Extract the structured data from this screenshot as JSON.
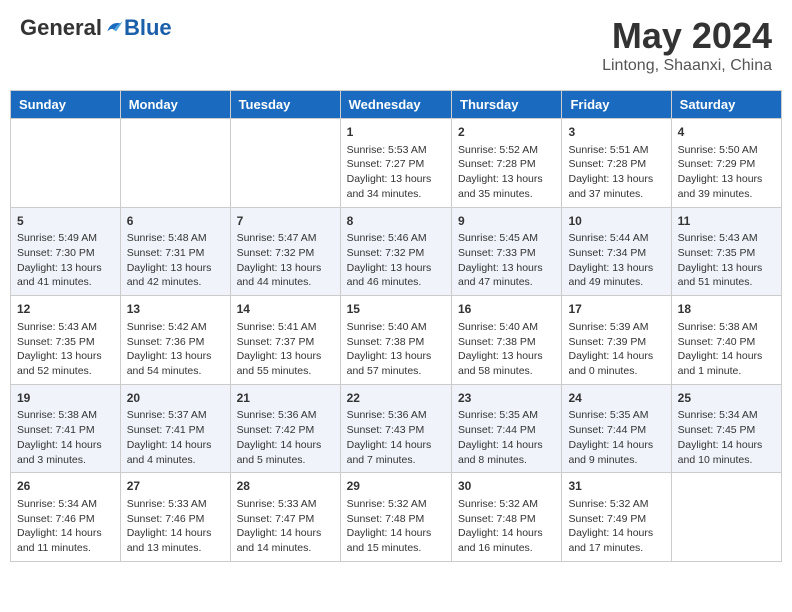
{
  "logo": {
    "general": "General",
    "blue": "Blue"
  },
  "title": "May 2024",
  "subtitle": "Lintong, Shaanxi, China",
  "days": [
    "Sunday",
    "Monday",
    "Tuesday",
    "Wednesday",
    "Thursday",
    "Friday",
    "Saturday"
  ],
  "weeks": [
    [
      {
        "day": "",
        "info": ""
      },
      {
        "day": "",
        "info": ""
      },
      {
        "day": "",
        "info": ""
      },
      {
        "day": "1",
        "info": "Sunrise: 5:53 AM\nSunset: 7:27 PM\nDaylight: 13 hours and 34 minutes."
      },
      {
        "day": "2",
        "info": "Sunrise: 5:52 AM\nSunset: 7:28 PM\nDaylight: 13 hours and 35 minutes."
      },
      {
        "day": "3",
        "info": "Sunrise: 5:51 AM\nSunset: 7:28 PM\nDaylight: 13 hours and 37 minutes."
      },
      {
        "day": "4",
        "info": "Sunrise: 5:50 AM\nSunset: 7:29 PM\nDaylight: 13 hours and 39 minutes."
      }
    ],
    [
      {
        "day": "5",
        "info": "Sunrise: 5:49 AM\nSunset: 7:30 PM\nDaylight: 13 hours and 41 minutes."
      },
      {
        "day": "6",
        "info": "Sunrise: 5:48 AM\nSunset: 7:31 PM\nDaylight: 13 hours and 42 minutes."
      },
      {
        "day": "7",
        "info": "Sunrise: 5:47 AM\nSunset: 7:32 PM\nDaylight: 13 hours and 44 minutes."
      },
      {
        "day": "8",
        "info": "Sunrise: 5:46 AM\nSunset: 7:32 PM\nDaylight: 13 hours and 46 minutes."
      },
      {
        "day": "9",
        "info": "Sunrise: 5:45 AM\nSunset: 7:33 PM\nDaylight: 13 hours and 47 minutes."
      },
      {
        "day": "10",
        "info": "Sunrise: 5:44 AM\nSunset: 7:34 PM\nDaylight: 13 hours and 49 minutes."
      },
      {
        "day": "11",
        "info": "Sunrise: 5:43 AM\nSunset: 7:35 PM\nDaylight: 13 hours and 51 minutes."
      }
    ],
    [
      {
        "day": "12",
        "info": "Sunrise: 5:43 AM\nSunset: 7:35 PM\nDaylight: 13 hours and 52 minutes."
      },
      {
        "day": "13",
        "info": "Sunrise: 5:42 AM\nSunset: 7:36 PM\nDaylight: 13 hours and 54 minutes."
      },
      {
        "day": "14",
        "info": "Sunrise: 5:41 AM\nSunset: 7:37 PM\nDaylight: 13 hours and 55 minutes."
      },
      {
        "day": "15",
        "info": "Sunrise: 5:40 AM\nSunset: 7:38 PM\nDaylight: 13 hours and 57 minutes."
      },
      {
        "day": "16",
        "info": "Sunrise: 5:40 AM\nSunset: 7:38 PM\nDaylight: 13 hours and 58 minutes."
      },
      {
        "day": "17",
        "info": "Sunrise: 5:39 AM\nSunset: 7:39 PM\nDaylight: 14 hours and 0 minutes."
      },
      {
        "day": "18",
        "info": "Sunrise: 5:38 AM\nSunset: 7:40 PM\nDaylight: 14 hours and 1 minute."
      }
    ],
    [
      {
        "day": "19",
        "info": "Sunrise: 5:38 AM\nSunset: 7:41 PM\nDaylight: 14 hours and 3 minutes."
      },
      {
        "day": "20",
        "info": "Sunrise: 5:37 AM\nSunset: 7:41 PM\nDaylight: 14 hours and 4 minutes."
      },
      {
        "day": "21",
        "info": "Sunrise: 5:36 AM\nSunset: 7:42 PM\nDaylight: 14 hours and 5 minutes."
      },
      {
        "day": "22",
        "info": "Sunrise: 5:36 AM\nSunset: 7:43 PM\nDaylight: 14 hours and 7 minutes."
      },
      {
        "day": "23",
        "info": "Sunrise: 5:35 AM\nSunset: 7:44 PM\nDaylight: 14 hours and 8 minutes."
      },
      {
        "day": "24",
        "info": "Sunrise: 5:35 AM\nSunset: 7:44 PM\nDaylight: 14 hours and 9 minutes."
      },
      {
        "day": "25",
        "info": "Sunrise: 5:34 AM\nSunset: 7:45 PM\nDaylight: 14 hours and 10 minutes."
      }
    ],
    [
      {
        "day": "26",
        "info": "Sunrise: 5:34 AM\nSunset: 7:46 PM\nDaylight: 14 hours and 11 minutes."
      },
      {
        "day": "27",
        "info": "Sunrise: 5:33 AM\nSunset: 7:46 PM\nDaylight: 14 hours and 13 minutes."
      },
      {
        "day": "28",
        "info": "Sunrise: 5:33 AM\nSunset: 7:47 PM\nDaylight: 14 hours and 14 minutes."
      },
      {
        "day": "29",
        "info": "Sunrise: 5:32 AM\nSunset: 7:48 PM\nDaylight: 14 hours and 15 minutes."
      },
      {
        "day": "30",
        "info": "Sunrise: 5:32 AM\nSunset: 7:48 PM\nDaylight: 14 hours and 16 minutes."
      },
      {
        "day": "31",
        "info": "Sunrise: 5:32 AM\nSunset: 7:49 PM\nDaylight: 14 hours and 17 minutes."
      },
      {
        "day": "",
        "info": ""
      }
    ]
  ]
}
